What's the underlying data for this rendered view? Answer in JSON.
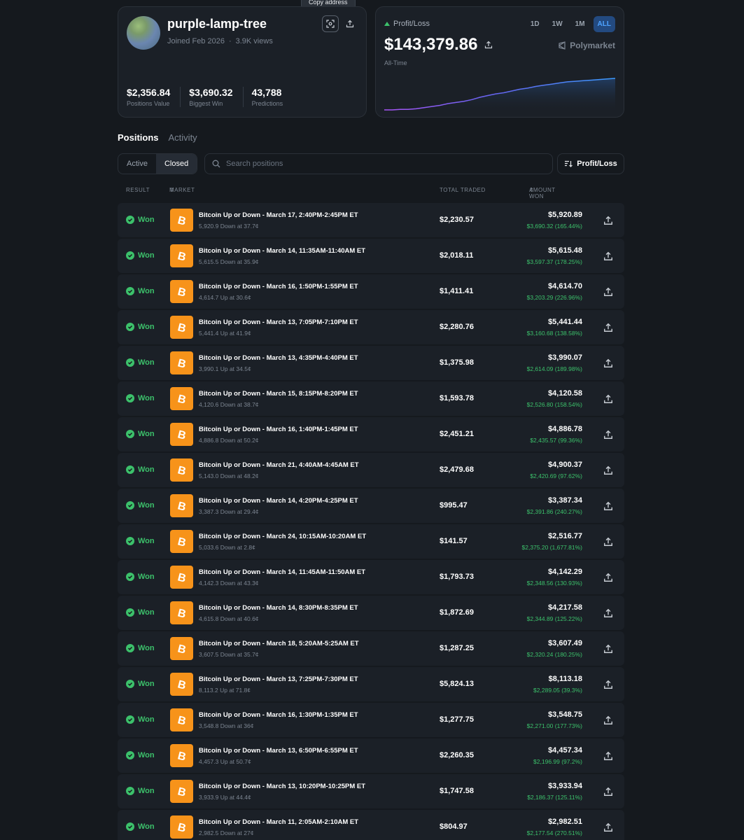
{
  "profile": {
    "username": "purple-lamp-tree",
    "joined": "Joined Feb 2026",
    "separator": "·",
    "views": "3.9K views",
    "tooltip": "Copy address",
    "stats": [
      {
        "value": "$2,356.84",
        "label": "Positions Value"
      },
      {
        "value": "$3,690.32",
        "label": "Biggest Win"
      },
      {
        "value": "43,788",
        "label": "Predictions"
      }
    ]
  },
  "pnl": {
    "label": "Profit/Loss",
    "value": "$143,379.86",
    "period": "All-Time",
    "brand": "Polymarket",
    "ranges": [
      "1D",
      "1W",
      "1M",
      "ALL"
    ],
    "active_range": "ALL",
    "accent": "#3a8fff",
    "series": [
      0,
      0,
      1,
      1,
      2,
      4,
      6,
      8,
      11,
      13,
      15,
      18,
      22,
      25,
      28,
      30,
      33,
      36,
      38,
      41,
      43,
      45,
      47,
      49,
      50,
      51,
      52,
      53,
      54,
      55
    ]
  },
  "nav": {
    "tabs": [
      "Positions",
      "Activity"
    ],
    "active_tab": "Positions",
    "toggle": [
      "Active",
      "Closed"
    ],
    "active_toggle": "Closed",
    "search_placeholder": "Search positions",
    "sort_label": "Profit/Loss"
  },
  "table": {
    "headers": {
      "result": "RESULT",
      "market": "MARKET",
      "total_traded": "TOTAL TRADED",
      "amount_won": "AMOUNT WON"
    },
    "rows": [
      {
        "result": "Won",
        "title": "Bitcoin Up or Down - March 17, 2:40PM-2:45PM ET",
        "sub": "5,920.9 Down at 37.7¢",
        "traded": "$2,230.57",
        "won": "$5,920.89",
        "gain": "$3,690.32 (165.44%)"
      },
      {
        "result": "Won",
        "title": "Bitcoin Up or Down - March 14, 11:35AM-11:40AM ET",
        "sub": "5,615.5 Down at 35.9¢",
        "traded": "$2,018.11",
        "won": "$5,615.48",
        "gain": "$3,597.37 (178.25%)"
      },
      {
        "result": "Won",
        "title": "Bitcoin Up or Down - March 16, 1:50PM-1:55PM ET",
        "sub": "4,614.7 Up at 30.6¢",
        "traded": "$1,411.41",
        "won": "$4,614.70",
        "gain": "$3,203.29 (226.96%)"
      },
      {
        "result": "Won",
        "title": "Bitcoin Up or Down - March 13, 7:05PM-7:10PM ET",
        "sub": "5,441.4 Up at 41.9¢",
        "traded": "$2,280.76",
        "won": "$5,441.44",
        "gain": "$3,160.68 (138.58%)"
      },
      {
        "result": "Won",
        "title": "Bitcoin Up or Down - March 13, 4:35PM-4:40PM ET",
        "sub": "3,990.1 Up at 34.5¢",
        "traded": "$1,375.98",
        "won": "$3,990.07",
        "gain": "$2,614.09 (189.98%)"
      },
      {
        "result": "Won",
        "title": "Bitcoin Up or Down - March 15, 8:15PM-8:20PM ET",
        "sub": "4,120.6 Down at 38.7¢",
        "traded": "$1,593.78",
        "won": "$4,120.58",
        "gain": "$2,526.80 (158.54%)"
      },
      {
        "result": "Won",
        "title": "Bitcoin Up or Down - March 16, 1:40PM-1:45PM ET",
        "sub": "4,886.8 Down at 50.2¢",
        "traded": "$2,451.21",
        "won": "$4,886.78",
        "gain": "$2,435.57 (99.36%)"
      },
      {
        "result": "Won",
        "title": "Bitcoin Up or Down - March 21, 4:40AM-4:45AM ET",
        "sub": "5,143.0 Down at 48.2¢",
        "traded": "$2,479.68",
        "won": "$4,900.37",
        "gain": "$2,420.69 (97.62%)"
      },
      {
        "result": "Won",
        "title": "Bitcoin Up or Down - March 14, 4:20PM-4:25PM ET",
        "sub": "3,387.3 Down at 29.4¢",
        "traded": "$995.47",
        "won": "$3,387.34",
        "gain": "$2,391.86 (240.27%)"
      },
      {
        "result": "Won",
        "title": "Bitcoin Up or Down - March 24, 10:15AM-10:20AM ET",
        "sub": "5,033.6 Down at 2.8¢",
        "traded": "$141.57",
        "won": "$2,516.77",
        "gain": "$2,375.20 (1,677.81%)"
      },
      {
        "result": "Won",
        "title": "Bitcoin Up or Down - March 14, 11:45AM-11:50AM ET",
        "sub": "4,142.3 Down at 43.3¢",
        "traded": "$1,793.73",
        "won": "$4,142.29",
        "gain": "$2,348.56 (130.93%)"
      },
      {
        "result": "Won",
        "title": "Bitcoin Up or Down - March 14, 8:30PM-8:35PM ET",
        "sub": "4,615.8 Down at 40.6¢",
        "traded": "$1,872.69",
        "won": "$4,217.58",
        "gain": "$2,344.89 (125.22%)"
      },
      {
        "result": "Won",
        "title": "Bitcoin Up or Down - March 18, 5:20AM-5:25AM ET",
        "sub": "3,607.5 Down at 35.7¢",
        "traded": "$1,287.25",
        "won": "$3,607.49",
        "gain": "$2,320.24 (180.25%)"
      },
      {
        "result": "Won",
        "title": "Bitcoin Up or Down - March 13, 7:25PM-7:30PM ET",
        "sub": "8,113.2 Up at 71.8¢",
        "traded": "$5,824.13",
        "won": "$8,113.18",
        "gain": "$2,289.05 (39.3%)"
      },
      {
        "result": "Won",
        "title": "Bitcoin Up or Down - March 16, 1:30PM-1:35PM ET",
        "sub": "3,548.8 Down at 36¢",
        "traded": "$1,277.75",
        "won": "$3,548.75",
        "gain": "$2,271.00 (177.73%)"
      },
      {
        "result": "Won",
        "title": "Bitcoin Up or Down - March 13, 6:50PM-6:55PM ET",
        "sub": "4,457.3 Up at 50.7¢",
        "traded": "$2,260.35",
        "won": "$4,457.34",
        "gain": "$2,196.99 (97.2%)"
      },
      {
        "result": "Won",
        "title": "Bitcoin Up or Down - March 13, 10:20PM-10:25PM ET",
        "sub": "3,933.9 Up at 44.4¢",
        "traded": "$1,747.58",
        "won": "$3,933.94",
        "gain": "$2,186.37 (125.11%)"
      },
      {
        "result": "Won",
        "title": "Bitcoin Up or Down - March 11, 2:05AM-2:10AM ET",
        "sub": "2,982.5 Down at 27¢",
        "traded": "$804.97",
        "won": "$2,982.51",
        "gain": "$2,177.54 (270.51%)"
      }
    ]
  }
}
